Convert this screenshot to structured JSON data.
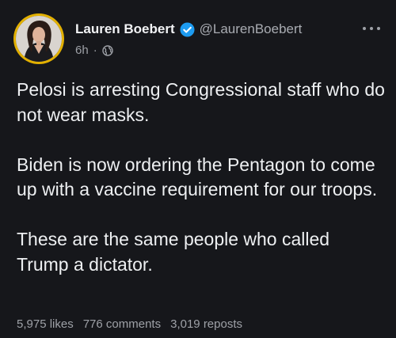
{
  "post": {
    "author_name": "Lauren Boebert",
    "handle": "@LaurenBoebert",
    "time": "6h",
    "separator": "·",
    "visibility_icon": "globe-icon",
    "verified_icon": "verified-check-icon",
    "more_icon": "more-horizontal-icon",
    "paragraphs": [
      "Pelosi is arresting Congressional staff who do not wear masks.",
      "Biden is now ordering the Pentagon to come up with a vaccine requirement for our troops.",
      "These are the same people who called Trump a dictator."
    ],
    "stats": {
      "likes": "5,975 likes",
      "comments": "776 comments",
      "reposts": "3,019 reposts"
    }
  },
  "colors": {
    "background": "#16171b",
    "avatar_ring": "#e2b000",
    "verified": "#1d9bf0",
    "text": "#eef0f2",
    "muted": "#9ea1a7"
  }
}
